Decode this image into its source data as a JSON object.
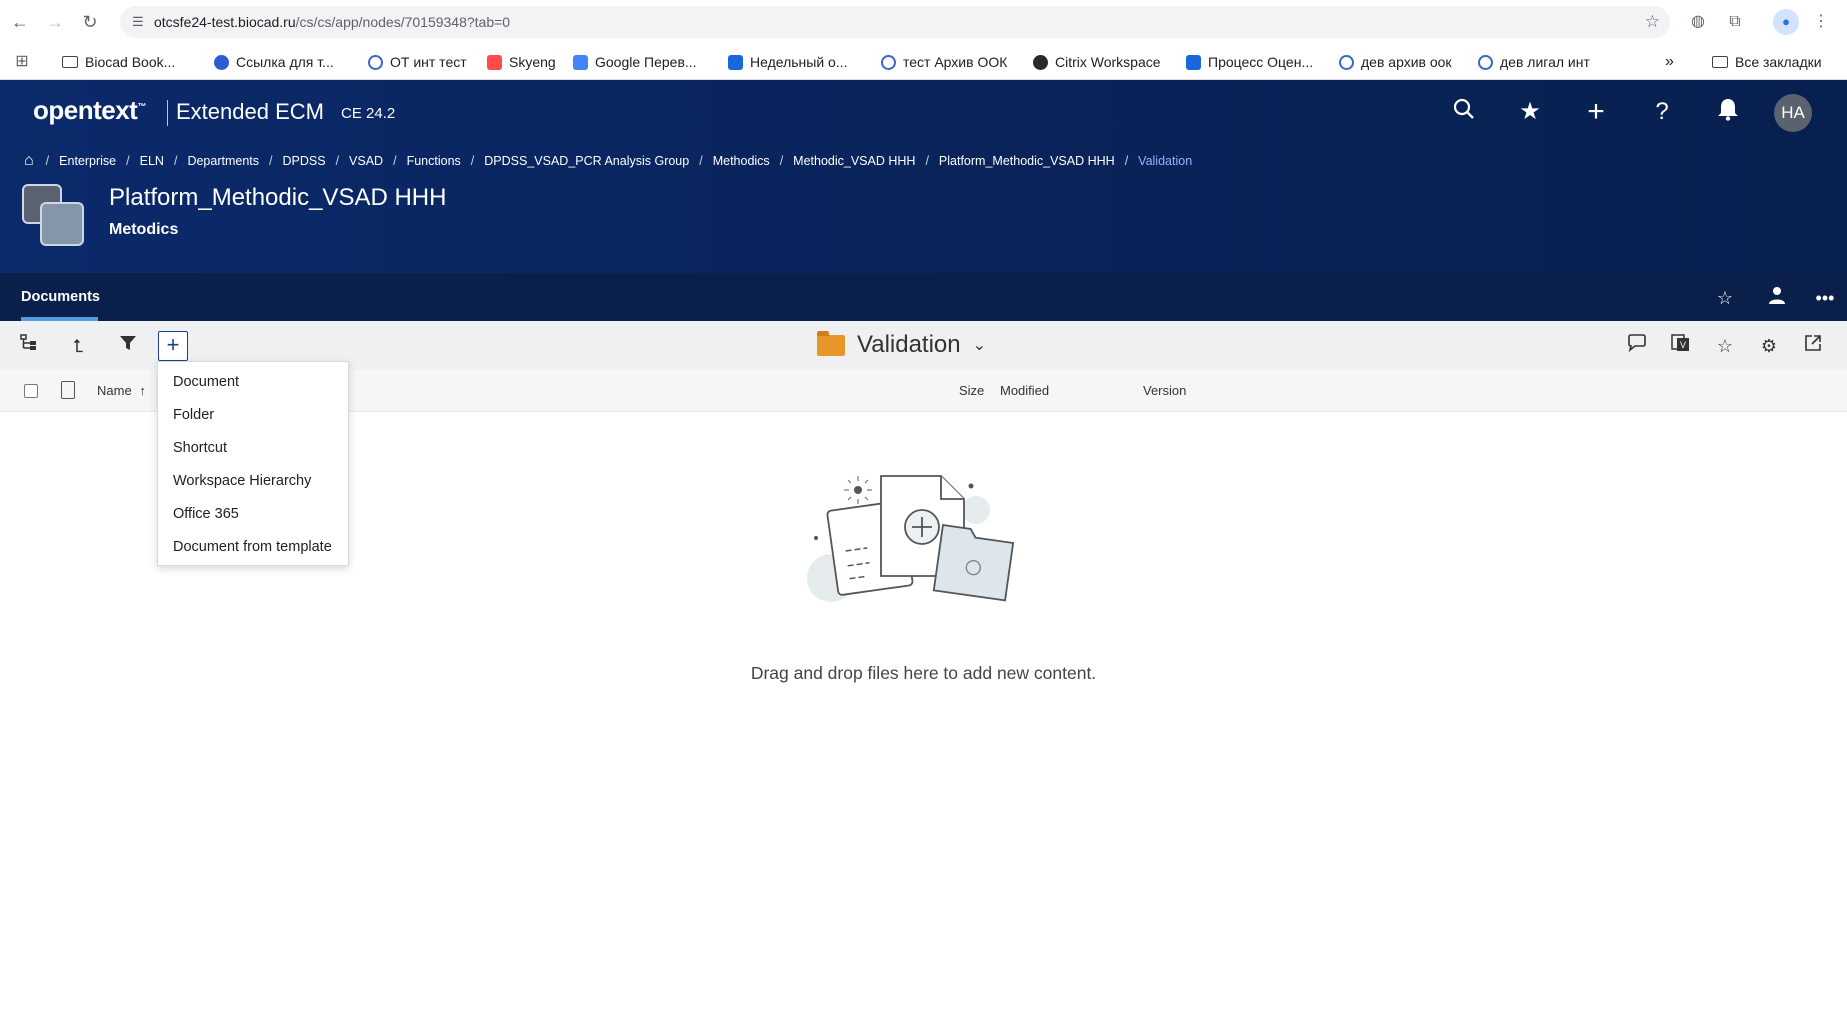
{
  "browser": {
    "url_host": "otcsfe24-test.biocad.ru",
    "url_path": "/cs/cs/app/nodes/70159348?tab=0",
    "bookmarks": [
      {
        "label": "Biocad Book..."
      },
      {
        "label": "Ссылка для т..."
      },
      {
        "label": "ОТ инт тест"
      },
      {
        "label": "Skyeng"
      },
      {
        "label": "Google Перев..."
      },
      {
        "label": "Недельный о..."
      },
      {
        "label": "тест Архив ООК"
      },
      {
        "label": "Citrix Workspace"
      },
      {
        "label": "Процесс Оцен..."
      },
      {
        "label": "дев архив оок"
      },
      {
        "label": "дев лигал инт"
      }
    ],
    "all_bookmarks": "Все закладки"
  },
  "app": {
    "logo": "opentext",
    "logo_tm": "™",
    "product": "Extended ECM",
    "version": "CE 24.2",
    "avatar_initials": "HA"
  },
  "breadcrumb": [
    "Enterprise",
    "ELN",
    "Departments",
    "DPDSS",
    "VSAD",
    "Functions",
    "DPDSS_VSAD_PCR Analysis Group",
    "Methodics",
    "Methodic_VSAD HHH",
    "Platform_Methodic_VSAD HHH"
  ],
  "breadcrumb_current": "Validation",
  "workspace": {
    "title": "Platform_Methodic_VSAD HHH",
    "subtitle": "Metodics"
  },
  "tabs": {
    "documents": "Documents"
  },
  "folder": {
    "name": "Validation"
  },
  "columns": {
    "name": "Name",
    "sort_arrow": "↑",
    "size": "Size",
    "modified": "Modified",
    "version": "Version"
  },
  "add_menu": {
    "items": [
      "Document",
      "Folder",
      "Shortcut",
      "Workspace Hierarchy",
      "Office 365",
      "Document from template"
    ]
  },
  "empty_state": {
    "text": "Drag and drop files here to add new content."
  }
}
